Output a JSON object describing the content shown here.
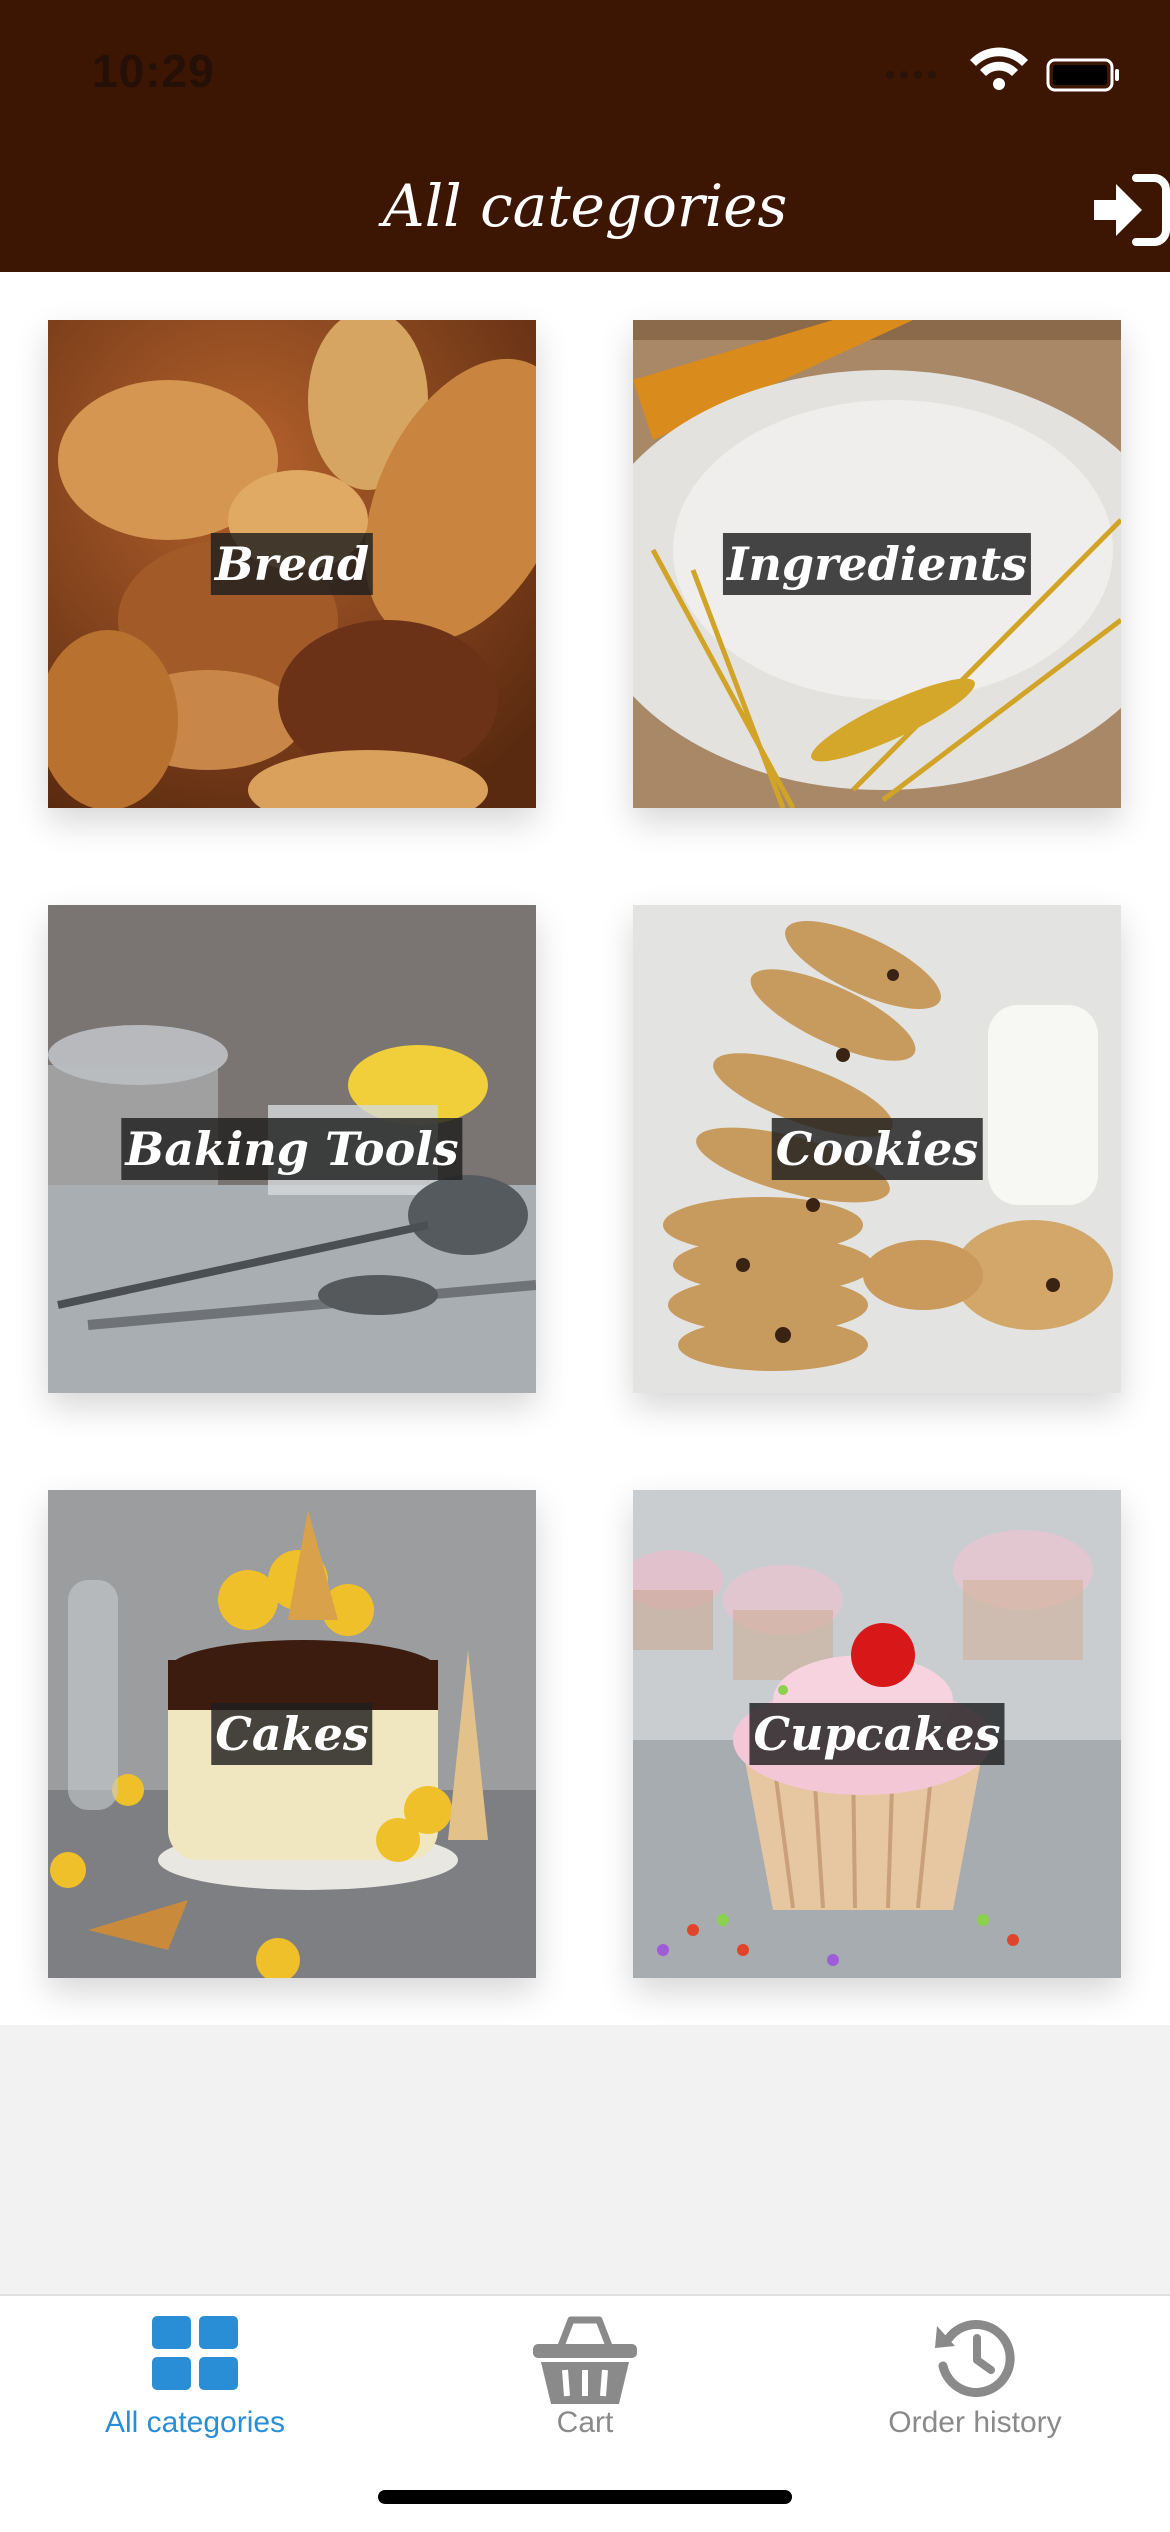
{
  "status_bar": {
    "time": "10:29"
  },
  "header": {
    "title": "All categories",
    "action_icon": "sign-in-icon"
  },
  "categories": [
    {
      "label": "Bread"
    },
    {
      "label": "Ingredients"
    },
    {
      "label": "Baking Tools"
    },
    {
      "label": "Cookies"
    },
    {
      "label": "Cakes"
    },
    {
      "label": "Cupcakes"
    }
  ],
  "tab_bar": {
    "tabs": [
      {
        "label": "All categories",
        "icon": "grid-icon",
        "active": true
      },
      {
        "label": "Cart",
        "icon": "basket-icon",
        "active": false
      },
      {
        "label": "Order history",
        "icon": "history-icon",
        "active": false
      }
    ],
    "active_color": "#2a8ed6",
    "inactive_color": "#8a8a8a"
  },
  "colors": {
    "header_bg": "#3d1503"
  }
}
